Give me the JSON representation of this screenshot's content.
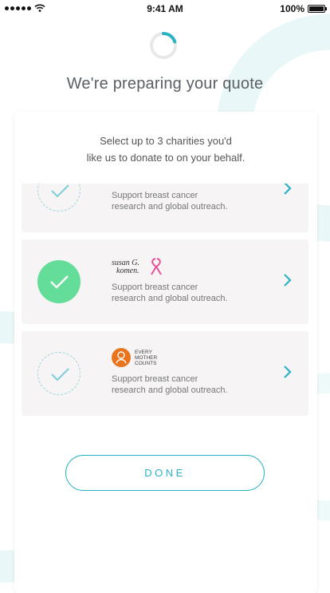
{
  "status_bar": {
    "time": "9:41 AM",
    "battery": "100%"
  },
  "header": {
    "title": "We're preparing your quote"
  },
  "card": {
    "intro_line1": "Select up to 3 charities you'd",
    "intro_line2": "like us to donate to on your behalf.",
    "done_label": "DONE"
  },
  "charities": [
    {
      "selected": false,
      "logo_text": "",
      "desc_line1": "Support breast cancer",
      "desc_line2": "research and global outreach."
    },
    {
      "selected": true,
      "logo_text": "susan G. komen.",
      "desc_line1": "Support breast cancer",
      "desc_line2": "research and global outreach."
    },
    {
      "selected": false,
      "logo_text": "EVERY MOTHER COUNTS",
      "desc_line1": "Support breast cancer",
      "desc_line2": "research and global outreach."
    }
  ],
  "colors": {
    "accent": "#2ab2c5",
    "selected": "#64dd99",
    "row_bg": "#f6f4f4",
    "decor": "#e6f5f7"
  }
}
